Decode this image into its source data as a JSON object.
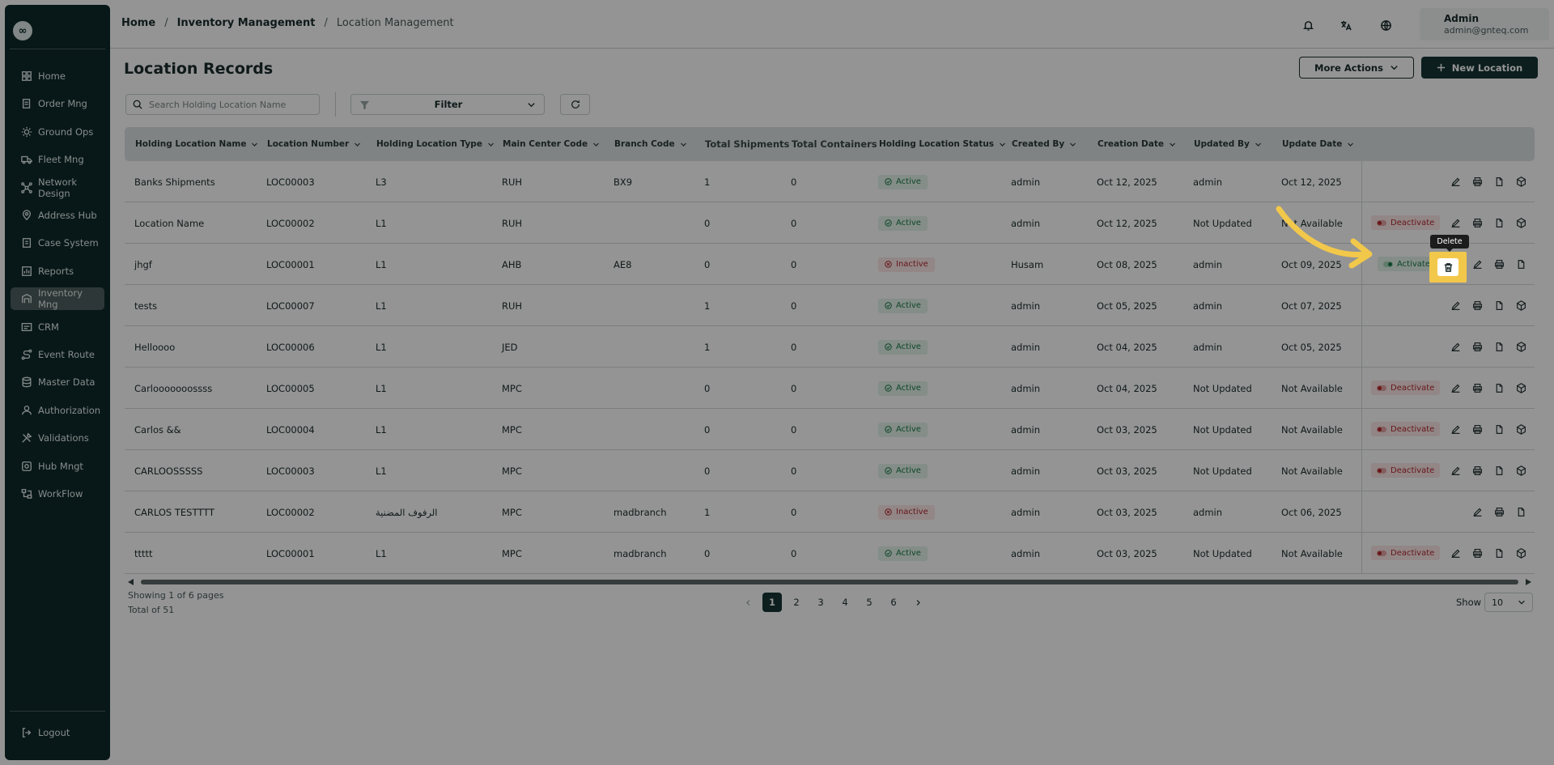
{
  "sidebar": {
    "logo": "∞",
    "items": [
      {
        "label": "Home",
        "icon": "grid-icon"
      },
      {
        "label": "Order Mng",
        "icon": "order-icon"
      },
      {
        "label": "Ground Ops",
        "icon": "sun-icon"
      },
      {
        "label": "Fleet Mng",
        "icon": "truck-icon"
      },
      {
        "label": "Network Design",
        "icon": "network-icon"
      },
      {
        "label": "Address Hub",
        "icon": "pin-icon"
      },
      {
        "label": "Case System",
        "icon": "case-icon"
      },
      {
        "label": "Reports",
        "icon": "report-icon"
      },
      {
        "label": "Inventory Mng",
        "icon": "inventory-icon"
      },
      {
        "label": "CRM",
        "icon": "crm-icon"
      },
      {
        "label": "Event Route",
        "icon": "route-icon"
      },
      {
        "label": "Master Data",
        "icon": "database-icon"
      },
      {
        "label": "Authorization",
        "icon": "user-icon"
      },
      {
        "label": "Validations",
        "icon": "tools-icon"
      },
      {
        "label": "Hub Mngt",
        "icon": "hub-icon"
      },
      {
        "label": "WorkFlow",
        "icon": "workflow-icon"
      }
    ],
    "active": "Inventory Mng",
    "logout": "Logout"
  },
  "breadcrumb": {
    "home": "Home",
    "section": "Inventory Management",
    "current": "Location Management",
    "sep": "/"
  },
  "user": {
    "name": "Admin",
    "email": "admin@gnteq.com"
  },
  "page": {
    "title": "Location Records",
    "more_actions": "More Actions",
    "new_location": "New Location",
    "search_placeholder": "Search Holding Location Name",
    "filter_label": "Filter"
  },
  "table": {
    "columns": [
      "Holding Location Name",
      "Location Number",
      "Holding Location Type",
      "Main Center Code",
      "Branch Code",
      "Total Shipments",
      "Total Containers",
      "Holding Location Status",
      "Created By",
      "Creation Date",
      "Updated By",
      "Update Date"
    ],
    "rows": [
      {
        "name": "Banks Shipments",
        "number": "LOC00003",
        "type": "L3",
        "center": "RUH",
        "branch": "BX9",
        "shipments": "1",
        "containers": "0",
        "status": "Active",
        "created_by": "admin",
        "created": "Oct 12, 2025",
        "updated_by": "admin",
        "updated": "Oct 12, 2025",
        "toggle": ""
      },
      {
        "name": "Location Name",
        "number": "LOC00002",
        "type": "L1",
        "center": "RUH",
        "branch": "",
        "shipments": "0",
        "containers": "0",
        "status": "Active",
        "created_by": "admin",
        "created": "Oct 12, 2025",
        "updated_by": "Not Updated",
        "updated": "Not Available",
        "toggle": "Deactivate"
      },
      {
        "name": "jhgf",
        "number": "LOC00001",
        "type": "L1",
        "center": "AHB",
        "branch": "AE8",
        "shipments": "0",
        "containers": "0",
        "status": "Inactive",
        "created_by": "Husam",
        "created": "Oct 08, 2025",
        "updated_by": "admin",
        "updated": "Oct 09, 2025",
        "toggle": "Activate"
      },
      {
        "name": "tests",
        "number": "LOC00007",
        "type": "L1",
        "center": "RUH",
        "branch": "",
        "shipments": "1",
        "containers": "0",
        "status": "Active",
        "created_by": "admin",
        "created": "Oct 05, 2025",
        "updated_by": "admin",
        "updated": "Oct 07, 2025",
        "toggle": ""
      },
      {
        "name": "Helloooo",
        "number": "LOC00006",
        "type": "L1",
        "center": "JED",
        "branch": "",
        "shipments": "1",
        "containers": "0",
        "status": "Active",
        "created_by": "admin",
        "created": "Oct 04, 2025",
        "updated_by": "admin",
        "updated": "Oct 05, 2025",
        "toggle": ""
      },
      {
        "name": "Carlooooooossss",
        "number": "LOC00005",
        "type": "L1",
        "center": "MPC",
        "branch": "",
        "shipments": "0",
        "containers": "0",
        "status": "Active",
        "created_by": "admin",
        "created": "Oct 04, 2025",
        "updated_by": "Not Updated",
        "updated": "Not Available",
        "toggle": "Deactivate"
      },
      {
        "name": "Carlos &&",
        "number": "LOC00004",
        "type": "L1",
        "center": "MPC",
        "branch": "",
        "shipments": "0",
        "containers": "0",
        "status": "Active",
        "created_by": "admin",
        "created": "Oct 03, 2025",
        "updated_by": "Not Updated",
        "updated": "Not Available",
        "toggle": "Deactivate"
      },
      {
        "name": "CARLOOSSSSS",
        "number": "LOC00003",
        "type": "L1",
        "center": "MPC",
        "branch": "",
        "shipments": "0",
        "containers": "0",
        "status": "Active",
        "created_by": "admin",
        "created": "Oct 03, 2025",
        "updated_by": "Not Updated",
        "updated": "Not Available",
        "toggle": "Deactivate"
      },
      {
        "name": "CARLOS TESTTTT",
        "number": "LOC00002",
        "type": "الرفوف المضنية",
        "center": "MPC",
        "branch": "madbranch",
        "shipments": "1",
        "containers": "0",
        "status": "Inactive",
        "created_by": "admin",
        "created": "Oct 03, 2025",
        "updated_by": "admin",
        "updated": "Oct 06, 2025",
        "toggle": ""
      },
      {
        "name": "ttttt",
        "number": "LOC00001",
        "type": "L1",
        "center": "MPC",
        "branch": "madbranch",
        "shipments": "0",
        "containers": "0",
        "status": "Active",
        "created_by": "admin",
        "created": "Oct 03, 2025",
        "updated_by": "Not Updated",
        "updated": "Not Available",
        "toggle": "Deactivate"
      }
    ]
  },
  "footer": {
    "showing": "Showing 1 of 6 pages",
    "total": "Total of 51",
    "pages": [
      "1",
      "2",
      "3",
      "4",
      "5",
      "6"
    ],
    "current_page": "1",
    "show_label": "Show",
    "page_size": "10"
  },
  "tooltip": {
    "label": "Delete"
  },
  "colors": {
    "brand": "#163434",
    "sidebar": "#0f2a2a",
    "highlight": "#f2c84b",
    "active": "#197a47",
    "inactive": "#b3282d"
  }
}
